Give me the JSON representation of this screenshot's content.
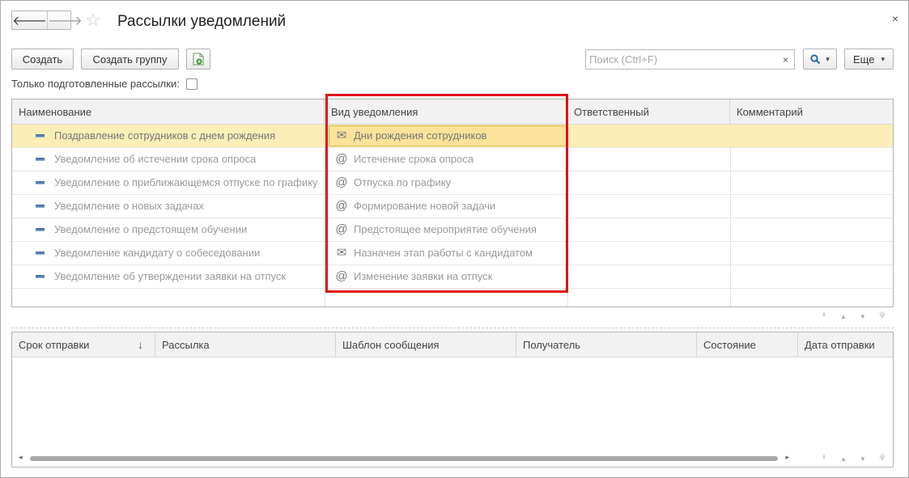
{
  "header": {
    "back_icon": "arrow-left-icon",
    "forward_icon": "arrow-right-icon",
    "favorite_icon": "star-icon",
    "title": "Рассылки уведомлений",
    "close_glyph": "×"
  },
  "toolbar": {
    "create_label": "Создать",
    "create_group_label": "Создать группу",
    "export_icon": "excel-export-icon",
    "search_placeholder": "Поиск (Ctrl+F)",
    "search_clear": "×",
    "search_button_icon": "search-icon",
    "more_label": "Еще",
    "dropdown_glyph": "▾"
  },
  "filter": {
    "label": "Только подготовленные рассылки:",
    "checked": false
  },
  "top_table": {
    "columns": [
      "Наименование",
      "Вид уведомления",
      "Ответственный",
      "Комментарий"
    ],
    "rows": [
      {
        "name": "Поздравление сотрудников с днем рождения",
        "kind_icon": "✉",
        "kind": "Дни рождения сотрудников",
        "responsible": "",
        "comment": ""
      },
      {
        "name": "Уведомление об истечении срока опроса",
        "kind_icon": "@",
        "kind": "Истечение срока опроса",
        "responsible": "",
        "comment": ""
      },
      {
        "name": "Уведомление о приближающемся отпуске по графику",
        "kind_icon": "@",
        "kind": "Отпуска по графику",
        "responsible": "",
        "comment": ""
      },
      {
        "name": "Уведомление о новых задачах",
        "kind_icon": "@",
        "kind": "Формирование новой задачи",
        "responsible": "",
        "comment": ""
      },
      {
        "name": "Уведомление о предстоящем обучении",
        "kind_icon": "@",
        "kind": "Предстоящее мероприятие обучения",
        "responsible": "",
        "comment": ""
      },
      {
        "name": "Уведомление кандидату о собеседовании",
        "kind_icon": "✉",
        "kind": "Назначен этап работы с кандидатом",
        "responsible": "",
        "comment": ""
      },
      {
        "name": "Уведомление об утверждении заявки на отпуск",
        "kind_icon": "@",
        "kind": "Изменение заявки на отпуск",
        "responsible": "",
        "comment": ""
      }
    ],
    "selected_row": 0
  },
  "pager_glyphs": [
    "⯒",
    "▲",
    "▼",
    "⯓"
  ],
  "bottom_table": {
    "columns": [
      "Срок отправки",
      "Рассылка",
      "Шаблон сообщения",
      "Получатель",
      "Состояние",
      "Дата отправки"
    ],
    "sort_glyph": "↓",
    "rows": []
  },
  "scroll_glyphs": [
    "◂",
    "▸"
  ],
  "colors": {
    "selection": "#fbeeb7",
    "highlight_frame": "#e0101b",
    "list_icon": "#5b7fb0"
  }
}
